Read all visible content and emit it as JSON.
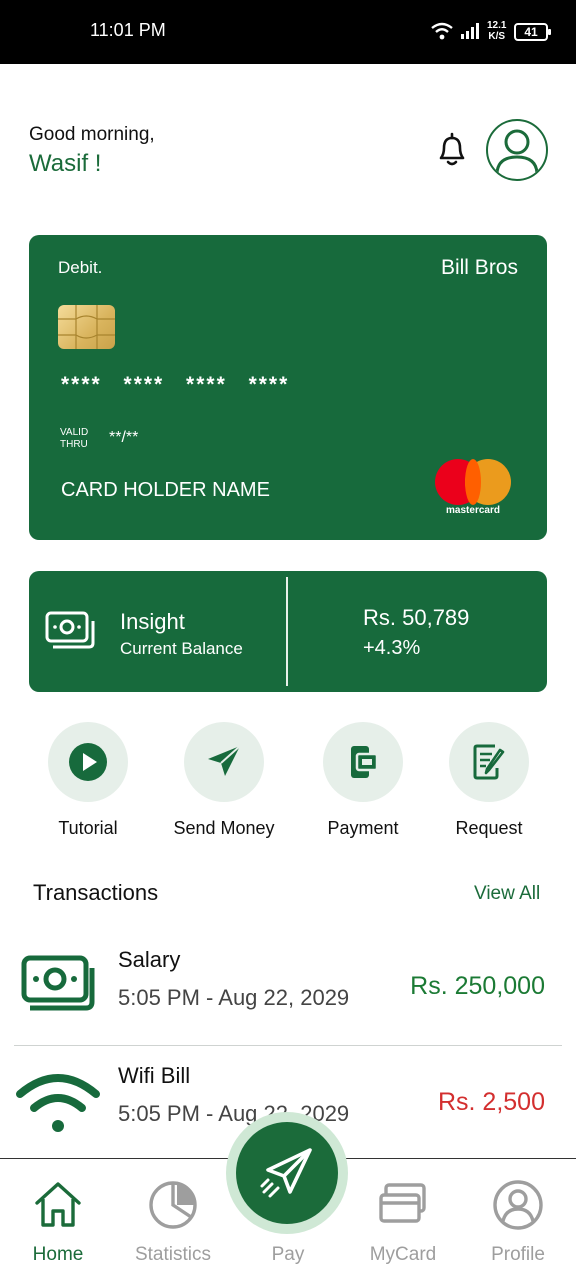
{
  "status_bar": {
    "time": "11:01 PM",
    "speed_value": "12.1",
    "speed_unit": "K/S",
    "battery": "41"
  },
  "header": {
    "greeting": "Good morning,",
    "username": "Wasif !"
  },
  "card": {
    "type": "Debit.",
    "bank": "Bill Bros",
    "number": "**** **** **** ****",
    "valid_label_1": "VALID",
    "valid_label_2": "THRU",
    "valid_value": "**/**",
    "holder": "CARD HOLDER NAME",
    "network": "mastercard"
  },
  "insight": {
    "title": "Insight",
    "subtitle": "Current Balance",
    "amount": "Rs. 50,789",
    "change": "+4.3%"
  },
  "actions": [
    {
      "label": "Tutorial",
      "icon": "play-icon"
    },
    {
      "label": "Send Money",
      "icon": "send-icon"
    },
    {
      "label": "Payment",
      "icon": "wallet-icon"
    },
    {
      "label": "Request",
      "icon": "document-edit-icon"
    }
  ],
  "transactions": {
    "title": "Transactions",
    "view_all": "View All",
    "items": [
      {
        "name": "Salary",
        "date": "5:05 PM - Aug 22, 2029",
        "amount": "Rs. 250,000",
        "color": "#1b7a34",
        "icon": "cash-icon"
      },
      {
        "name": "Wifi Bill",
        "date": "5:05 PM - Aug 22, 2029",
        "amount": "Rs. 2,500",
        "color": "#d32f2f",
        "icon": "wifi-icon"
      }
    ]
  },
  "nav": {
    "home": "Home",
    "statistics": "Statistics",
    "pay": "Pay",
    "mycard": "MyCard",
    "profile": "Profile"
  },
  "colors": {
    "primary": "#176a3c",
    "accent_light": "#e6efe9",
    "inactive": "#9e9e9e"
  }
}
